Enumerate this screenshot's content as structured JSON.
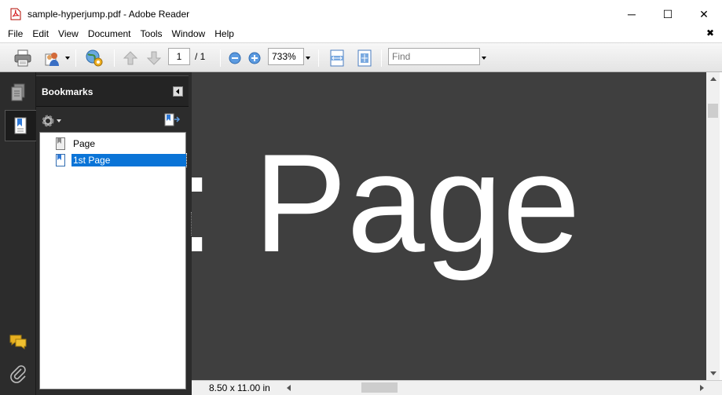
{
  "window": {
    "title": "sample-hyperjump.pdf - Adobe Reader",
    "app_icon": "pdf-file-icon",
    "controls": {
      "minimize": "─",
      "maximize": "☐",
      "close": "✕"
    }
  },
  "menubar": {
    "items": [
      "File",
      "Edit",
      "View",
      "Document",
      "Tools",
      "Window",
      "Help"
    ],
    "close_doc": "✖"
  },
  "toolbar": {
    "page_number": "1",
    "page_total": "/ 1",
    "zoom": "733%",
    "find_placeholder": "Find"
  },
  "bookmarks": {
    "title": "Bookmarks",
    "items": [
      {
        "label": "Page",
        "selected": false
      },
      {
        "label": "1st Page",
        "selected": true
      }
    ]
  },
  "document": {
    "visible_text": ": Page",
    "background": "#3f3f3f"
  },
  "status": {
    "page_size": "8.50 x 11.00 in"
  },
  "colors": {
    "selection": "#0a74d7",
    "panel_dark": "#2c2c2c"
  }
}
